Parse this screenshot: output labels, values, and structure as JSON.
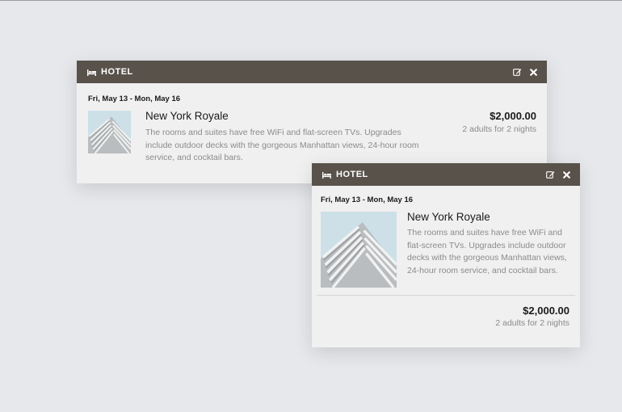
{
  "colors": {
    "header_bg": "#58524b",
    "card_bg": "#f0f0f0",
    "page_bg": "#e6e8ec",
    "muted_text": "#8b8b8b"
  },
  "cards": [
    {
      "header": {
        "icon": "bed-icon",
        "title": "HOTEL",
        "actions": [
          "edit-icon",
          "close-icon"
        ]
      },
      "dates": "Fri, May 13 - Mon, May 16",
      "hotel_name": "New York Royale",
      "description": "The rooms and suites have free WiFi and flat-screen TVs. Upgrades include outdoor decks with the gorgeous Manhattan views, 24-hour room service, and cocktail bars.",
      "price": "$2,000.00",
      "guests": "2 adults for 2 nights"
    },
    {
      "header": {
        "icon": "bed-icon",
        "title": "HOTEL",
        "actions": [
          "edit-icon",
          "close-icon"
        ]
      },
      "dates": "Fri, May 13 - Mon, May 16",
      "hotel_name": "New York Royale",
      "description": "The rooms and suites have free WiFi and flat-screen TVs. Upgrades include outdoor decks with the gorgeous Manhattan views, 24-hour room service, and cocktail bars.",
      "price": "$2,000.00",
      "guests": "2 adults for 2 nights"
    }
  ]
}
